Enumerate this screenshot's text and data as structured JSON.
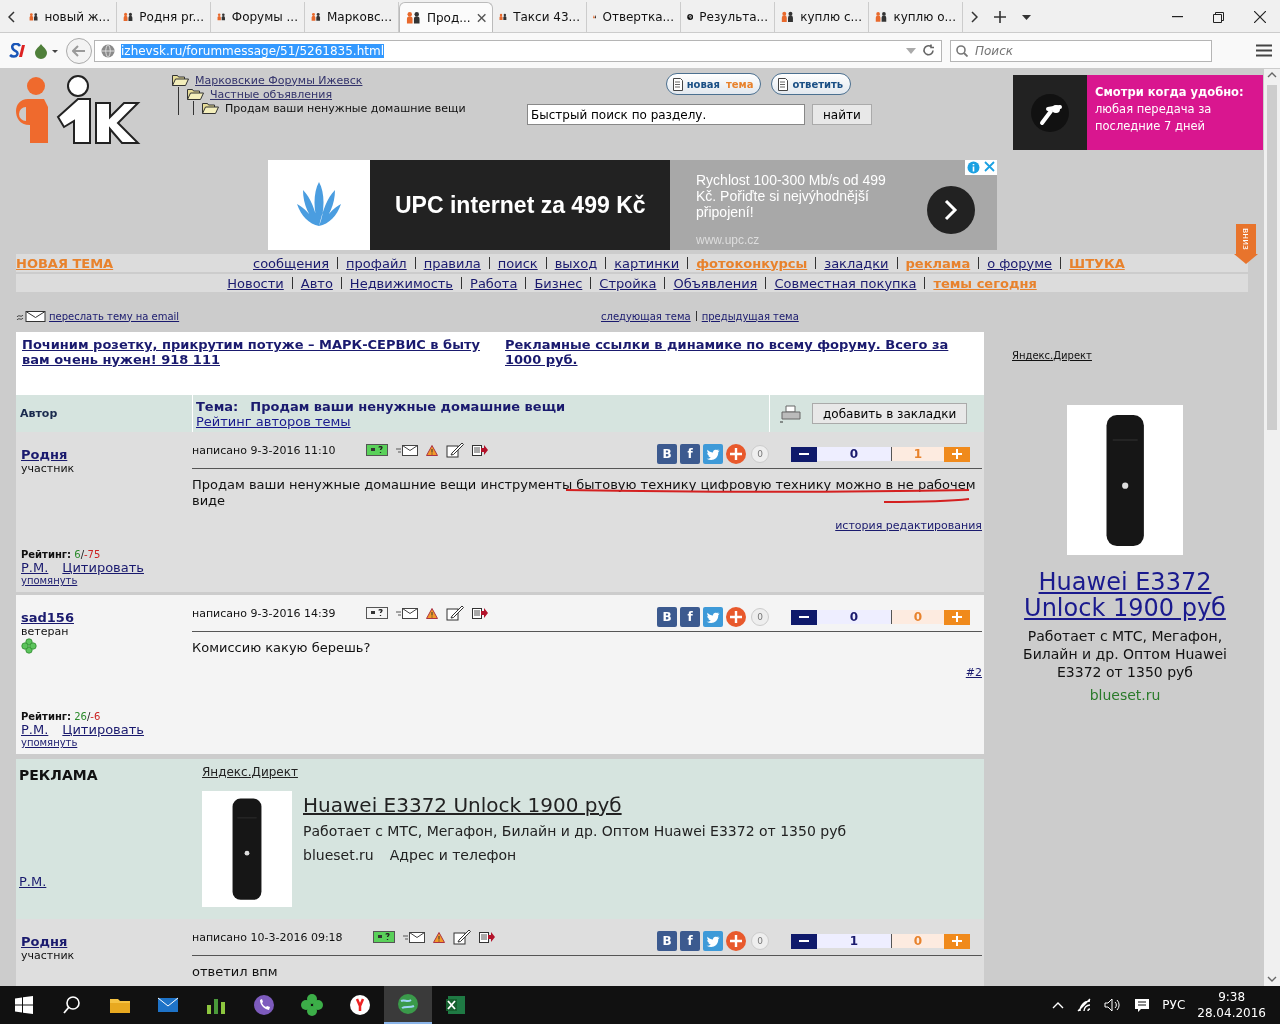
{
  "browser": {
    "tabs": [
      {
        "title": "новый ж...",
        "kind": "forum",
        "selected": false
      },
      {
        "title": "Родня pr...",
        "kind": "forum",
        "selected": false
      },
      {
        "title": "Форумы ...",
        "kind": "forum",
        "selected": false
      },
      {
        "title": "Марковс...",
        "kind": "forum",
        "selected": false
      },
      {
        "title": "Прод...",
        "kind": "forum",
        "selected": true
      },
      {
        "title": "Такси 43...",
        "kind": "forum",
        "selected": false
      },
      {
        "title": "Отвертка...",
        "kind": "forum",
        "selected": false
      },
      {
        "title": "Результа...",
        "kind": "counter",
        "selected": false
      },
      {
        "title": "куплю с...",
        "kind": "forum",
        "selected": false
      },
      {
        "title": "куплю о...",
        "kind": "forum",
        "selected": false
      }
    ],
    "url": "izhevsk.ru/forummessage/51/5261835.html",
    "url_selected": true,
    "search": {
      "placeholder": "Поиск"
    }
  },
  "header": {
    "tree": [
      {
        "label": "Марковские Форумы Ижевск",
        "current": false,
        "children": [
          {
            "label": "Частные объявления",
            "current": false,
            "children": [
              {
                "label": "Продам ваши ненужные домашние вещи",
                "current": true
              }
            ]
          }
        ]
      }
    ],
    "buttons": [
      {
        "parts": [
          "новая",
          "тема"
        ]
      },
      {
        "parts": [
          "ответить"
        ]
      }
    ],
    "search": {
      "value": "Быстрый поиск по разделу.",
      "button": "найти"
    },
    "banner": {
      "title": "Смотри когда удобно:",
      "text": "любая передача за последние 7 дней"
    }
  },
  "upc_ad": {
    "headline": "UPC internet za 499 Kč",
    "text": "Rychlost 100-300 Mb/s od 499 Kč. Pořiďte si nejvýhodnější připojení!",
    "url": "www.upc.cz"
  },
  "nav": {
    "new_topic": "НОВАЯ ТЕМА",
    "down": "вниз",
    "row_1": [
      {
        "label": "сообщения",
        "kind": "plain"
      },
      {
        "label": "профайл",
        "kind": "plain"
      },
      {
        "label": "правила",
        "kind": "plain"
      },
      {
        "label": "поиск",
        "kind": "plain"
      },
      {
        "label": "выход",
        "kind": "plain"
      },
      {
        "label": "картинки",
        "kind": "plain"
      },
      {
        "label": "фотоконкурсы",
        "kind": "promo"
      },
      {
        "label": "закладки",
        "kind": "plain"
      },
      {
        "label": "реклама",
        "kind": "promo"
      },
      {
        "label": "о форуме",
        "kind": "plain"
      },
      {
        "label": "ШТУКА",
        "kind": "promo"
      }
    ],
    "row_2": [
      {
        "label": "Новости",
        "kind": "plain"
      },
      {
        "label": "Авто",
        "kind": "plain"
      },
      {
        "label": "Недвижимость",
        "kind": "plain"
      },
      {
        "label": "Работа",
        "kind": "plain"
      },
      {
        "label": "Бизнес",
        "kind": "plain"
      },
      {
        "label": "Стройка",
        "kind": "plain"
      },
      {
        "label": "Объявления",
        "kind": "plain"
      },
      {
        "label": "Совместная покупка",
        "kind": "plain"
      },
      {
        "label": "темы сегодня",
        "kind": "promo"
      }
    ]
  },
  "topic_links": {
    "email": "переслать тему на email",
    "next": "следующая тема",
    "prev": "предыдущая тема"
  },
  "ad_links": [
    "Починим розетку, прикрутим потуже – МАРК-СЕРВИС в быту вам очень нужен! 918 111",
    "Рекламные ссылки в динамике по всему форуму. Всего за 1000 руб."
  ],
  "thread": {
    "author_label": "Автор",
    "topic_label": "Тема:",
    "topic": "Продам ваши ненужные домашние вещи",
    "rating_link": "Рейтинг авторов темы",
    "bookmark": "добавить в закладки"
  },
  "posts": [
    {
      "kind": "post",
      "author": "Родня",
      "role": "участник",
      "badge": false,
      "rating": {
        "label": "Рейтинг:",
        "up": "6",
        "sep": "/",
        "down": "-75"
      },
      "pm": "Р.М.",
      "quote": "Цитировать",
      "mention": "упомянуть",
      "date": "написано 9-3-2016 11:10",
      "online": true,
      "share": [
        "В",
        "f"
      ],
      "share_count": "0",
      "votes_down": "0",
      "votes_up": "1",
      "body": "Продам ваши ненужные домашние вещи инструменты бытовую технику цифровую технику можно в не рабочем виде",
      "underlined": true,
      "footer_link": "история редактирования"
    },
    {
      "kind": "post",
      "author": "sad156",
      "role": "ветеран",
      "badge": true,
      "rating": {
        "label": "Рейтинг:",
        "up": "26",
        "sep": "/",
        "down": "-6"
      },
      "pm": "Р.М.",
      "quote": "Цитировать",
      "mention": "упомянуть",
      "date": "написано 9-3-2016 14:39",
      "online": false,
      "share": [
        "В",
        "f"
      ],
      "share_count": "0",
      "votes_down": "0",
      "votes_up": "0",
      "body": "Комиссию какую берешь?",
      "underlined": false,
      "footer_link": "#2"
    },
    {
      "kind": "ad",
      "label": "РЕКЛАМА",
      "source": "Яндекс.Директ",
      "title": "Huawei E3372 Unlock 1900 руб",
      "text": "Работает с МТС, Мегафон, Билайн и др. Оптом Huawei E3372 от 1350 руб",
      "domain": "blueset.ru",
      "contact": "Адрес и телефон",
      "pm": "Р.М."
    },
    {
      "kind": "post",
      "author": "Родня",
      "role": "участник",
      "badge": false,
      "date": "написано 10-3-2016 09:18",
      "online": true,
      "share": [
        "В",
        "f"
      ],
      "share_count": "0",
      "votes_down": "1",
      "votes_up": "0",
      "body": "ответил впм",
      "underlined": false
    }
  ],
  "side_ad": {
    "source": "Яндекс.Директ",
    "title": "Huawei E3372 Unlock 1900 руб",
    "text": "Работает с МТС, Мегафон, Билайн и др. Оптом Huawei E3372 от 1350 руб",
    "domain": "blueset.ru"
  },
  "taskbar": {
    "apps": [
      {
        "kind": "folder",
        "active": false
      },
      {
        "kind": "mail",
        "active": false
      },
      {
        "kind": "chart",
        "active": false
      },
      {
        "kind": "phone",
        "active": false
      },
      {
        "kind": "clover",
        "active": false
      },
      {
        "kind": "yandex",
        "active": false
      },
      {
        "kind": "globe",
        "active": true
      },
      {
        "kind": "excel",
        "active": false
      }
    ],
    "lang": "РУС",
    "time": "9:38",
    "date": "28.04.2016"
  }
}
